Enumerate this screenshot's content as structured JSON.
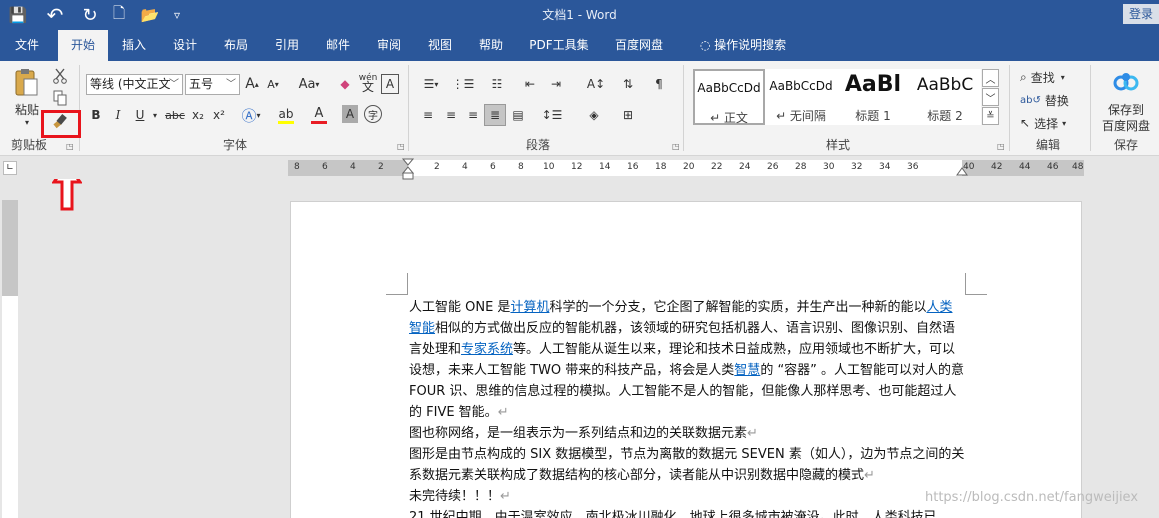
{
  "window": {
    "title": "文档1  -  Word",
    "login_label": "登录"
  },
  "qat": {
    "save": "💾",
    "undo": "↶",
    "redo": "↻",
    "new": "🗋",
    "open": "📂",
    "customize": "▿"
  },
  "tabs": [
    "文件",
    "开始",
    "插入",
    "设计",
    "布局",
    "引用",
    "邮件",
    "审阅",
    "视图",
    "帮助",
    "PDF工具集",
    "百度网盘"
  ],
  "tell_me": {
    "icon": "lightbulb-icon",
    "label": "操作说明搜索"
  },
  "clipboard": {
    "paste_label": "粘贴",
    "group_label": "剪贴板"
  },
  "font": {
    "font_name": "等线 (中文正文",
    "font_size": "五号",
    "grow": "A",
    "shrink": "A",
    "case": "Aa",
    "bold": "B",
    "italic": "I",
    "underline": "U",
    "strike": "abc",
    "sub": "x₂",
    "sup": "x²",
    "group_label": "字体"
  },
  "paragraph": {
    "group_label": "段落"
  },
  "styles": {
    "items": [
      {
        "preview": "AaBbCcDd",
        "name": "↵ 正文"
      },
      {
        "preview": "AaBbCcDd",
        "name": "↵ 无间隔"
      },
      {
        "preview": "AaBl",
        "name": "标题 1"
      },
      {
        "preview": "AaBbC",
        "name": "标题 2"
      }
    ],
    "group_label": "样式"
  },
  "editing": {
    "find": "查找",
    "replace": "替换",
    "select": "选择",
    "group_label": "编辑"
  },
  "save_group": {
    "button_line1": "保存到",
    "button_line2": "百度网盘",
    "group_label": "保存"
  },
  "ruler": {
    "ticks": [
      "8",
      "6",
      "4",
      "2",
      "2",
      "4",
      "6",
      "8",
      "10",
      "12",
      "14",
      "16",
      "18",
      "20",
      "22",
      "24",
      "26",
      "28",
      "30",
      "32",
      "34",
      "36",
      "40",
      "42",
      "44",
      "46",
      "48"
    ]
  },
  "document": {
    "paragraphs": [
      {
        "segments": [
          {
            "text": "人工智能 ONE 是"
          },
          {
            "text": "计算机",
            "link": true
          },
          {
            "text": "科学的一个分支，它企图了解智能的实质，并生产出一种新的能以"
          },
          {
            "text": "人类智能",
            "link": true
          },
          {
            "text": "相似的方式做出反应的智能机器，该领域的研究包括机器人、语言识别、图像识别、自然语言处理和"
          },
          {
            "text": "专家系统",
            "link": true
          },
          {
            "text": "等。人工智能从诞生以来，理论和技术日益成熟，应用领域也不断扩大，可以设想，未来人工智能 TWO 带来的科技产品，将会是人类"
          },
          {
            "text": "智慧",
            "link": true
          },
          {
            "text": "的 “容器” 。人工智能可以对人的意 FOUR 识、思维的信息过程的模拟。人工智能不是人的智能，但能像人那样思考、也可能超过人的 FIVE 智能。"
          },
          {
            "text": "↵",
            "mark": true
          }
        ]
      },
      {
        "segments": [
          {
            "text": "图也称网络，是一组表示为一系列结点和边的关联数据元素"
          },
          {
            "text": "↵",
            "mark": true
          }
        ]
      },
      {
        "segments": [
          {
            "text": "图形是由节点构成的 SIX 数据模型，节点为离散的数据元 SEVEN 素（如人），边为节点之间的关系数据元素关联构成了数据结构的核心部分，读者能从中识别数据中隐藏的模式"
          },
          {
            "text": "↵",
            "mark": true
          }
        ]
      },
      {
        "segments": [
          {
            "text": "未完待续！！！"
          },
          {
            "text": "↵",
            "mark": true
          }
        ]
      },
      {
        "segments": [
          {
            "text": "21 世纪中期，由于温室效应，南北极冰川融化，地球上很多城市被淹没。此时，人类科技已"
          }
        ]
      }
    ]
  },
  "watermark": "https://blog.csdn.net/fangweijiex"
}
